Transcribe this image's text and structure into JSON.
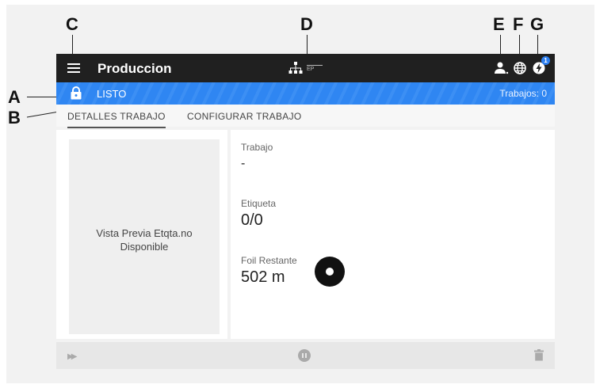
{
  "callouts": {
    "a": "A",
    "b": "B",
    "c": "C",
    "d": "D",
    "e": "E",
    "f": "F",
    "g": "G"
  },
  "topbar": {
    "title": "Produccion",
    "network_label": "EP",
    "notification_count": "1"
  },
  "status": {
    "state": "LISTO",
    "jobs": "Trabajos: 0",
    "color": "#2f86f2"
  },
  "tabs": [
    {
      "label": "DETALLES TRABAJO"
    },
    {
      "label": "CONFIGURAR TRABAJO"
    }
  ],
  "preview": {
    "line1": "Vista Previa Etqta.no",
    "line2": "Disponible"
  },
  "details": {
    "job_label": "Trabajo",
    "job_value": "-",
    "label_label": "Etiqueta",
    "label_value": "0/0",
    "foil_label": "Foil Restante",
    "foil_value": "502 m"
  },
  "icons": {
    "menu": "menu-icon",
    "network": "network-icon",
    "user": "user-icon",
    "globe": "globe-icon",
    "power": "power-icon",
    "lock": "lock-icon",
    "foil": "foil-roll-icon",
    "fast_forward": "fast-forward-icon",
    "pause": "pause-icon",
    "trash": "trash-icon"
  }
}
